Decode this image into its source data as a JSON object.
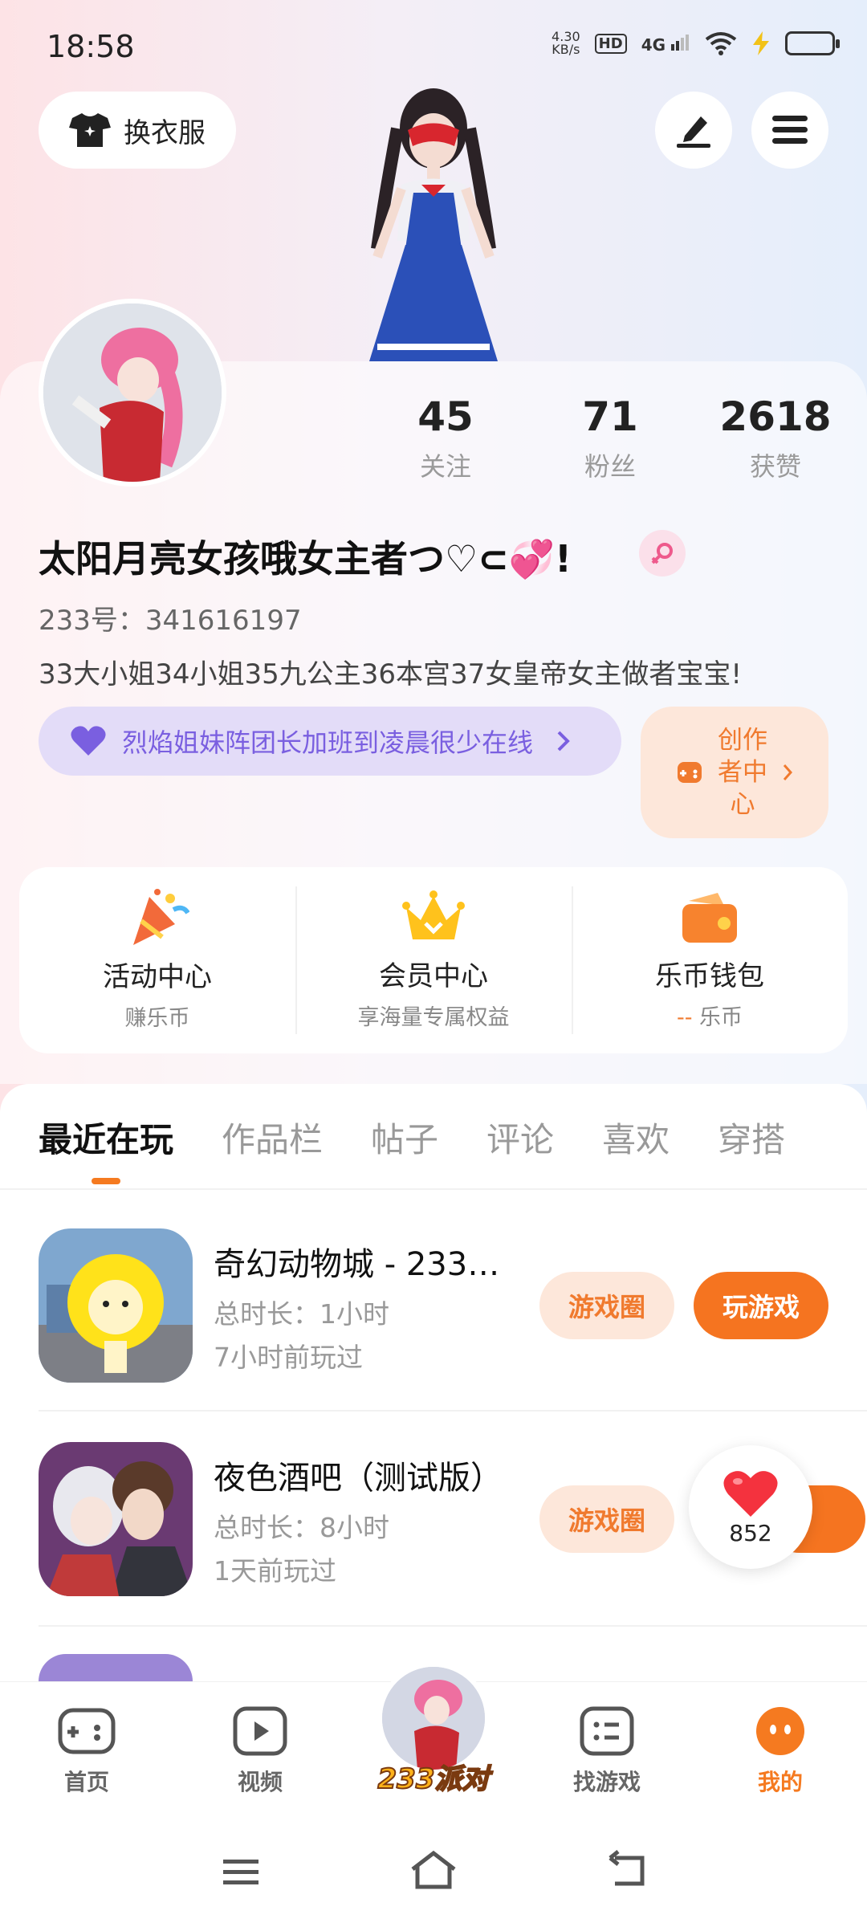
{
  "status_bar": {
    "time": "18:58",
    "net_speed": "4.30",
    "net_unit": "KB/s",
    "hd": "HD",
    "network": "4G"
  },
  "header": {
    "dress_label": "换衣服"
  },
  "profile": {
    "following_count": "45",
    "following_label": "关注",
    "fans_count": "71",
    "fans_label": "粉丝",
    "likes_count": "2618",
    "likes_label": "获赞",
    "username": "太阳月亮女孩哦女主者つ♡⊂💞!",
    "uid": "233号：341616197",
    "bio": "33大小姐34小姐35九公主36本宫37女皇帝女主做者宝宝!",
    "status_text": "烈焰姐妹阵团长加班到凌晨很少在线",
    "creator_label": "创作者中心"
  },
  "quick_panel": [
    {
      "title": "活动中心",
      "sub": "赚乐币"
    },
    {
      "title": "会员中心",
      "sub": "享海量专属权益"
    },
    {
      "title": "乐币钱包",
      "sub_dash": "--",
      "sub": "乐币"
    }
  ],
  "tabs": [
    "最近在玩",
    "作品栏",
    "帖子",
    "评论",
    "喜欢",
    "穿搭"
  ],
  "games": [
    {
      "name": "奇幻动物城 - 233…",
      "duration": "总时长：1小时",
      "last_played": "7小时前玩过",
      "circle_label": "游戏圈",
      "play_label": "玩游戏"
    },
    {
      "name": "夜色酒吧（测试版）",
      "duration": "总时长：8小时",
      "last_played": "1天前玩过",
      "circle_label": "游戏圈"
    }
  ],
  "like_bubble": {
    "count": "852"
  },
  "bottom_nav": {
    "home": "首页",
    "video": "视频",
    "party": "233派对",
    "find_game": "找游戏",
    "mine": "我的"
  },
  "colors": {
    "accent": "#f57420",
    "accent_light": "#fde7da",
    "status_pill_bg": "#e3dcf8",
    "status_pill_text": "#7a5fe0"
  }
}
